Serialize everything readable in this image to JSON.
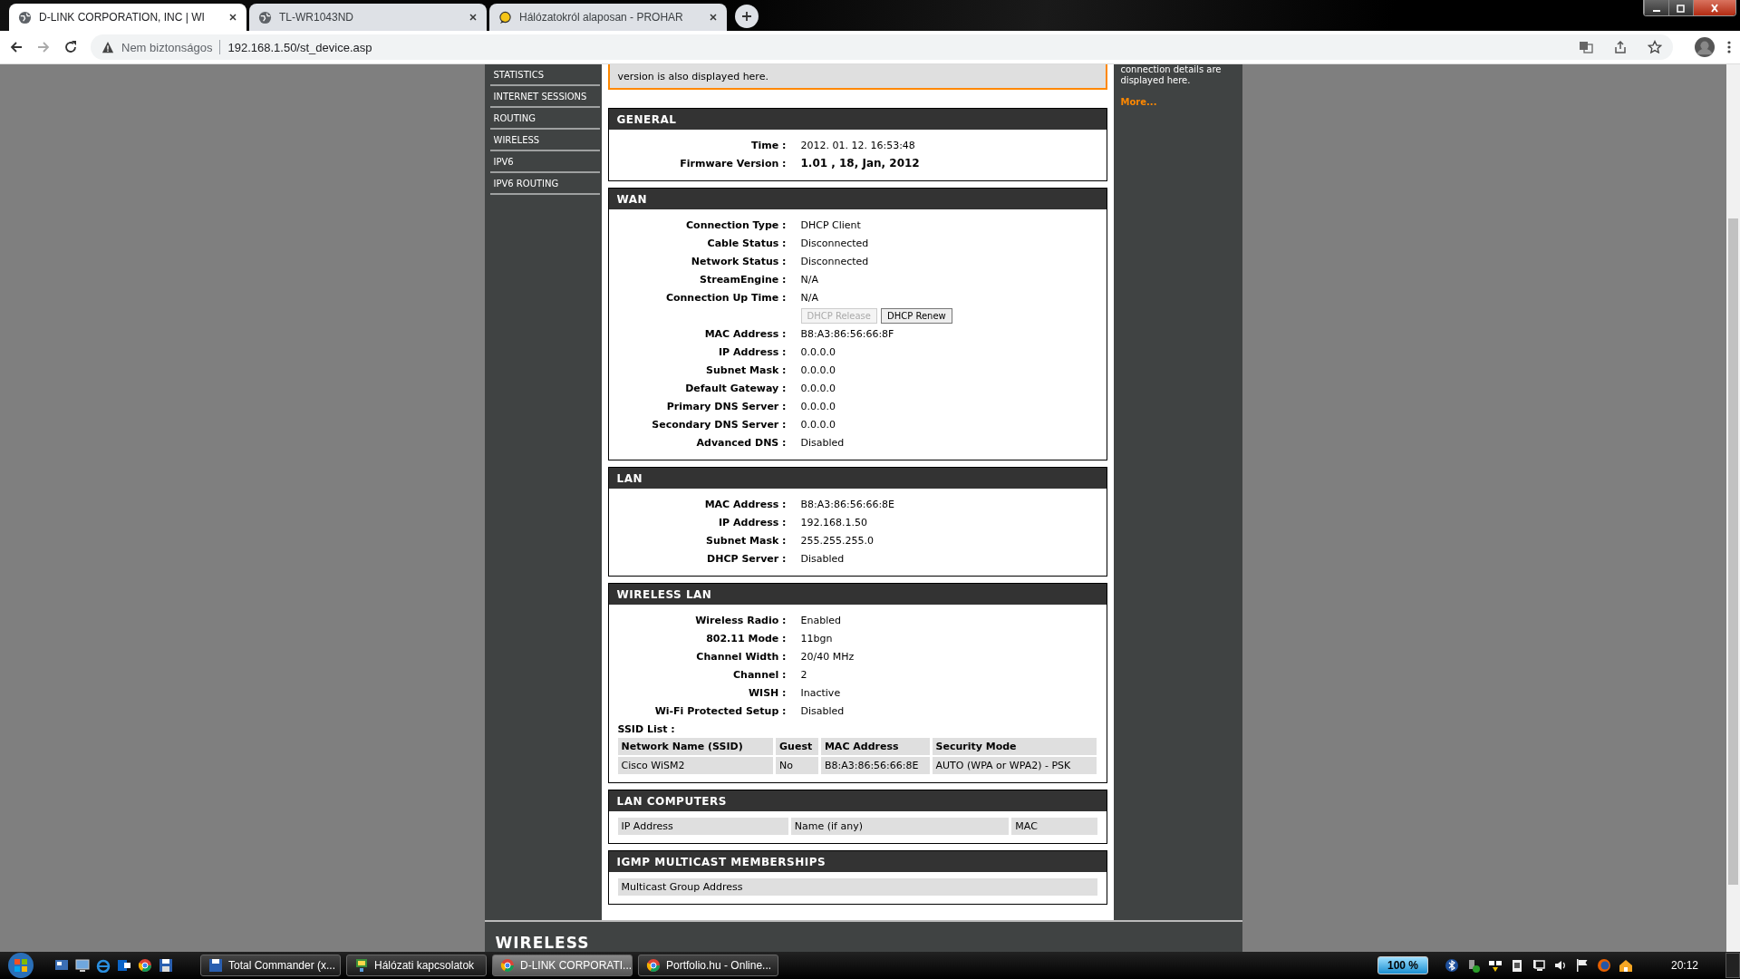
{
  "browser": {
    "tabs": [
      {
        "title": "D-LINK CORPORATION, INC | WI",
        "selected": true
      },
      {
        "title": "TL-WR1043ND",
        "selected": false
      },
      {
        "title": "Hálózatokról alaposan - PROHAR",
        "selected": false
      }
    ],
    "security": "Nem biztonságos",
    "url": "192.168.1.50/st_device.asp"
  },
  "sidebar": {
    "items": [
      "STATISTICS",
      "INTERNET SESSIONS",
      "ROUTING",
      "WIRELESS",
      "IPV6",
      "IPV6 ROUTING"
    ]
  },
  "notice": "version is also displayed here.",
  "right_panel": {
    "lines": [
      "connection details are",
      "displayed here."
    ],
    "link": "More..."
  },
  "sections": [
    {
      "title": "GENERAL",
      "rows": [
        {
          "kind": "row",
          "label": "Time :",
          "value": "2012. 01. 12. 16:53:48",
          "bold": false
        },
        {
          "kind": "row",
          "label": "Firmware Version :",
          "value": "1.01 , 18, Jan, 2012",
          "bold": true
        }
      ]
    },
    {
      "title": "WAN",
      "rows": [
        {
          "kind": "row",
          "label": "Connection Type :",
          "value": "DHCP Client",
          "bold": false
        },
        {
          "kind": "row",
          "label": "Cable Status :",
          "value": "Disconnected",
          "bold": false
        },
        {
          "kind": "row",
          "label": "Network Status :",
          "value": "Disconnected",
          "bold": false
        },
        {
          "kind": "row",
          "label": "StreamEngine :",
          "value": "N/A",
          "bold": false
        },
        {
          "kind": "row",
          "label": "Connection Up Time :",
          "value": "N/A",
          "bold": false
        },
        {
          "kind": "buttons",
          "buttons": [
            {
              "label": "DHCP Release",
              "disabled": true
            },
            {
              "label": "DHCP Renew",
              "disabled": false
            }
          ]
        },
        {
          "kind": "row",
          "label": "MAC Address :",
          "value": "B8:A3:86:56:66:8F",
          "bold": false
        },
        {
          "kind": "row",
          "label": "IP Address :",
          "value": "0.0.0.0",
          "bold": false
        },
        {
          "kind": "row",
          "label": "Subnet Mask :",
          "value": "0.0.0.0",
          "bold": false
        },
        {
          "kind": "row",
          "label": "Default Gateway :",
          "value": "0.0.0.0",
          "bold": false
        },
        {
          "kind": "row",
          "label": "Primary DNS Server :",
          "value": "0.0.0.0",
          "bold": false
        },
        {
          "kind": "row",
          "label": "Secondary DNS Server :",
          "value": "0.0.0.0",
          "bold": false
        },
        {
          "kind": "row",
          "label": "Advanced DNS :",
          "value": "Disabled",
          "bold": false
        }
      ]
    },
    {
      "title": "LAN",
      "rows": [
        {
          "kind": "row",
          "label": "MAC Address :",
          "value": "B8:A3:86:56:66:8E",
          "bold": false
        },
        {
          "kind": "row",
          "label": "IP Address :",
          "value": "192.168.1.50",
          "bold": false
        },
        {
          "kind": "row",
          "label": "Subnet Mask :",
          "value": "255.255.255.0",
          "bold": false
        },
        {
          "kind": "row",
          "label": "DHCP Server :",
          "value": "Disabled",
          "bold": false
        }
      ]
    },
    {
      "title": "WIRELESS LAN",
      "rows": [
        {
          "kind": "row",
          "label": "Wireless Radio :",
          "value": "Enabled",
          "bold": false
        },
        {
          "kind": "row",
          "label": "802.11 Mode :",
          "value": "11bgn",
          "bold": false
        },
        {
          "kind": "row",
          "label": "Channel Width :",
          "value": "20/40 MHz",
          "bold": false
        },
        {
          "kind": "row",
          "label": "Channel :",
          "value": "2",
          "bold": false
        },
        {
          "kind": "row",
          "label": "WISH :",
          "value": "Inactive",
          "bold": false
        },
        {
          "kind": "row",
          "label": "Wi-Fi Protected Setup :",
          "value": "Disabled",
          "bold": false
        },
        {
          "kind": "caption",
          "label": "SSID List :"
        },
        {
          "kind": "table",
          "header_bold": true,
          "columns": [
            "Network Name (SSID)",
            "Guest",
            "MAC Address",
            "Security Mode"
          ],
          "rows": [
            [
              "Cisco WiSM2",
              "No",
              "B8:A3:86:56:66:8E",
              "AUTO (WPA or WPA2) - PSK"
            ]
          ]
        }
      ]
    },
    {
      "title": "LAN COMPUTERS",
      "rows": [
        {
          "kind": "table",
          "header_bold": false,
          "columns": [
            "IP Address",
            "Name (if any)",
            "MAC"
          ],
          "rows": []
        }
      ]
    },
    {
      "title": "IGMP MULTICAST MEMBERSHIPS",
      "rows": [
        {
          "kind": "table",
          "header_bold": false,
          "columns": [
            "Multicast Group Address"
          ],
          "rows": []
        }
      ]
    }
  ],
  "footer_heading": "WIRELESS",
  "taskbar": {
    "tasks": [
      {
        "label": "Total Commander (x...",
        "selected": false
      },
      {
        "label": "Hálózati kapcsolatok",
        "selected": false
      },
      {
        "label": "D-LINK CORPORATI...",
        "selected": true
      },
      {
        "label": "Portfolio.hu - Online...",
        "selected": false
      }
    ],
    "battery": "100 %",
    "clock": "20:12"
  }
}
